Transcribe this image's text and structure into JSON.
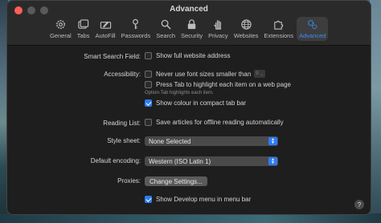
{
  "window": {
    "title": "Advanced"
  },
  "toolbar": {
    "tabs": [
      {
        "label": "General",
        "icon": "gear-icon"
      },
      {
        "label": "Tabs",
        "icon": "tabs-icon"
      },
      {
        "label": "AutoFill",
        "icon": "autofill-icon"
      },
      {
        "label": "Passwords",
        "icon": "key-icon"
      },
      {
        "label": "Search",
        "icon": "search-icon"
      },
      {
        "label": "Security",
        "icon": "lock-icon"
      },
      {
        "label": "Privacy",
        "icon": "hand-icon"
      },
      {
        "label": "Websites",
        "icon": "globe-icon"
      },
      {
        "label": "Extensions",
        "icon": "puzzle-icon"
      },
      {
        "label": "Advanced",
        "icon": "gears-icon",
        "active": true
      }
    ]
  },
  "settings": {
    "smart_search": {
      "label": "Smart Search Field:",
      "option": "Show full website address",
      "checked": false
    },
    "accessibility": {
      "label": "Accessibility:",
      "font_option": "Never use font sizes smaller than",
      "font_size": "9",
      "font_checked": false,
      "tab_option": "Press Tab to highlight each item on a web page",
      "tab_checked": false,
      "tab_hint": "Option-Tab highlights each item.",
      "colour_option": "Show colour in compact tab bar",
      "colour_checked": true
    },
    "reading_list": {
      "label": "Reading List:",
      "option": "Save articles for offline reading automatically",
      "checked": false
    },
    "style_sheet": {
      "label": "Style sheet:",
      "value": "None Selected"
    },
    "encoding": {
      "label": "Default encoding:",
      "value": "Western (ISO Latin 1)"
    },
    "proxies": {
      "label": "Proxies:",
      "button": "Change Settings..."
    },
    "develop": {
      "option": "Show Develop menu in menu bar",
      "checked": true
    }
  },
  "help": {
    "label": "?"
  },
  "colors": {
    "accent": "#2e7cf6",
    "window_bg": "#1e1e1e",
    "titlebar_bg": "#2a2a2a",
    "close": "#ff5f57"
  }
}
